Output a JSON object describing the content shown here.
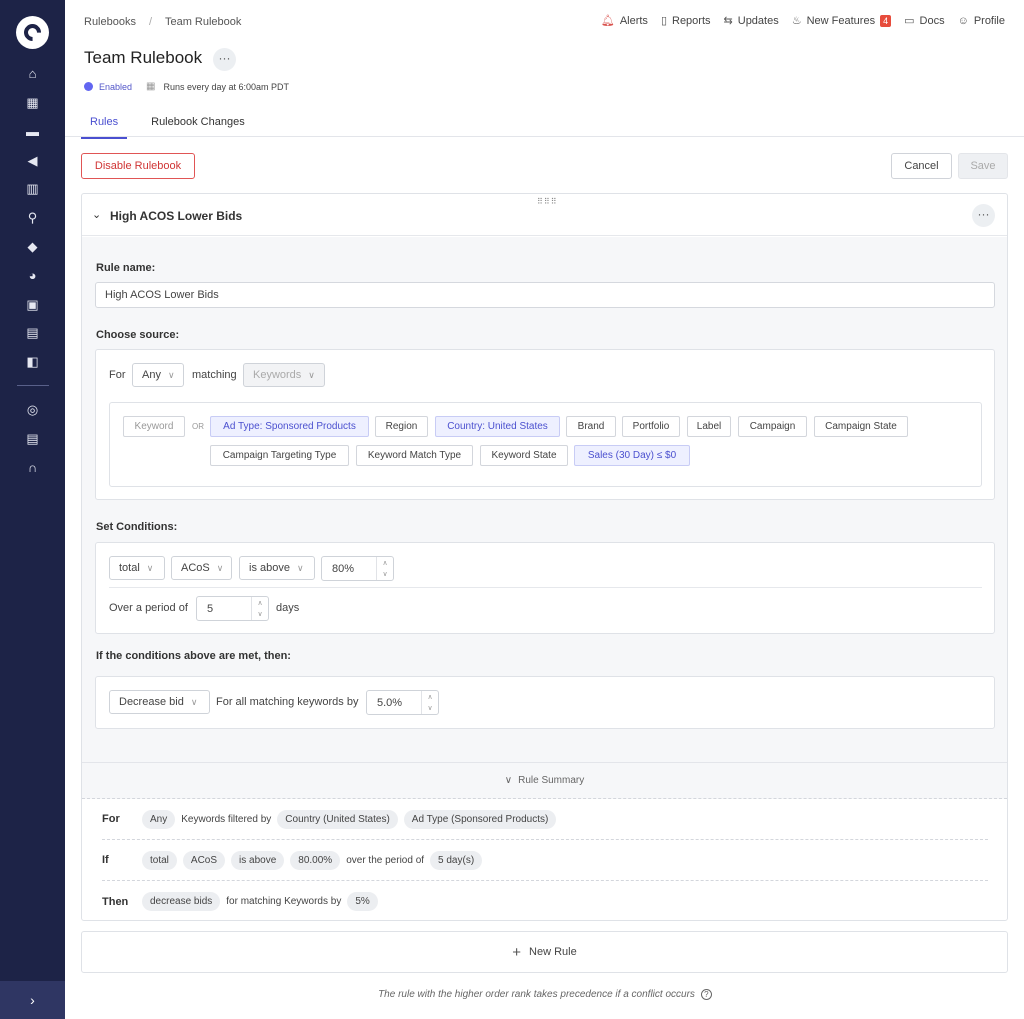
{
  "sidebar": {
    "logo": "logo-icon",
    "icons": [
      "home-icon",
      "store-icon",
      "folder-icon",
      "megaphone-icon",
      "barcode-icon",
      "search-icon",
      "tag-icon",
      "pie-chart-icon",
      "dashboard-icon",
      "calendar-icon",
      "board-icon",
      "globe-icon",
      "report-icon",
      "headset-icon"
    ],
    "expand": "›"
  },
  "breadcrumb": {
    "root": "Rulebooks",
    "sep": "/",
    "current": "Team Rulebook"
  },
  "topnav": {
    "alerts": "Alerts",
    "reports": "Reports",
    "updates": "Updates",
    "new_features": "New Features",
    "new_features_count": "4",
    "docs": "Docs",
    "profile": "Profile"
  },
  "page": {
    "title": "Team Rulebook",
    "more": "···",
    "status": "Enabled",
    "schedule": "Runs every day at 6:00am PDT"
  },
  "tabs": {
    "rules": "Rules",
    "changes": "Rulebook Changes"
  },
  "actions": {
    "disable": "Disable Rulebook",
    "cancel": "Cancel",
    "save": "Save"
  },
  "rule": {
    "title": "High ACOS Lower Bids",
    "drag": "⠿⠿⠿",
    "rule_name_label": "Rule name:",
    "rule_name_value": "High ACOS Lower Bids",
    "choose_source_label": "Choose source:",
    "for_label": "For",
    "for_value": "Any",
    "matching_label": "matching",
    "matching_value": "Keywords",
    "filter_chips": {
      "keyword": "Keyword",
      "or": "OR",
      "ad_type": "Ad Type: Sponsored Products",
      "region": "Region",
      "country": "Country: United States",
      "brand": "Brand",
      "portfolio": "Portfolio",
      "label": "Label",
      "campaign": "Campaign",
      "campaign_state": "Campaign State",
      "targeting_type": "Campaign Targeting Type",
      "match_type": "Keyword Match Type",
      "keyword_state": "Keyword State",
      "sales": "Sales (30 Day) ≤ $0"
    },
    "conditions_label": "Set Conditions:",
    "cond_agg": "total",
    "cond_metric": "ACoS",
    "cond_op": "is above",
    "cond_value": "80%",
    "period_label": "Over a period of",
    "period_value": "5",
    "period_unit": "days",
    "then_label": "If the conditions above are met, then:",
    "action": "Decrease bid",
    "action_text": "For all matching keywords by",
    "action_value": "5.0%",
    "summary_label": "Rule Summary",
    "summary": {
      "for_key": "For",
      "for_any": "Any",
      "for_text": "Keywords filtered by",
      "for_country": "Country (United States)",
      "for_adtype": "Ad Type (Sponsored Products)",
      "if_key": "If",
      "if_total": "total",
      "if_acos": "ACoS",
      "if_op": "is above",
      "if_value": "80.00%",
      "if_text": "over the period of",
      "if_days": "5 day(s)",
      "then_key": "Then",
      "then_action": "decrease bids",
      "then_text": "for matching Keywords by",
      "then_value": "5%"
    }
  },
  "new_rule": "New Rule",
  "footer_note": "The rule with the higher order rank takes precedence if a conflict occurs"
}
